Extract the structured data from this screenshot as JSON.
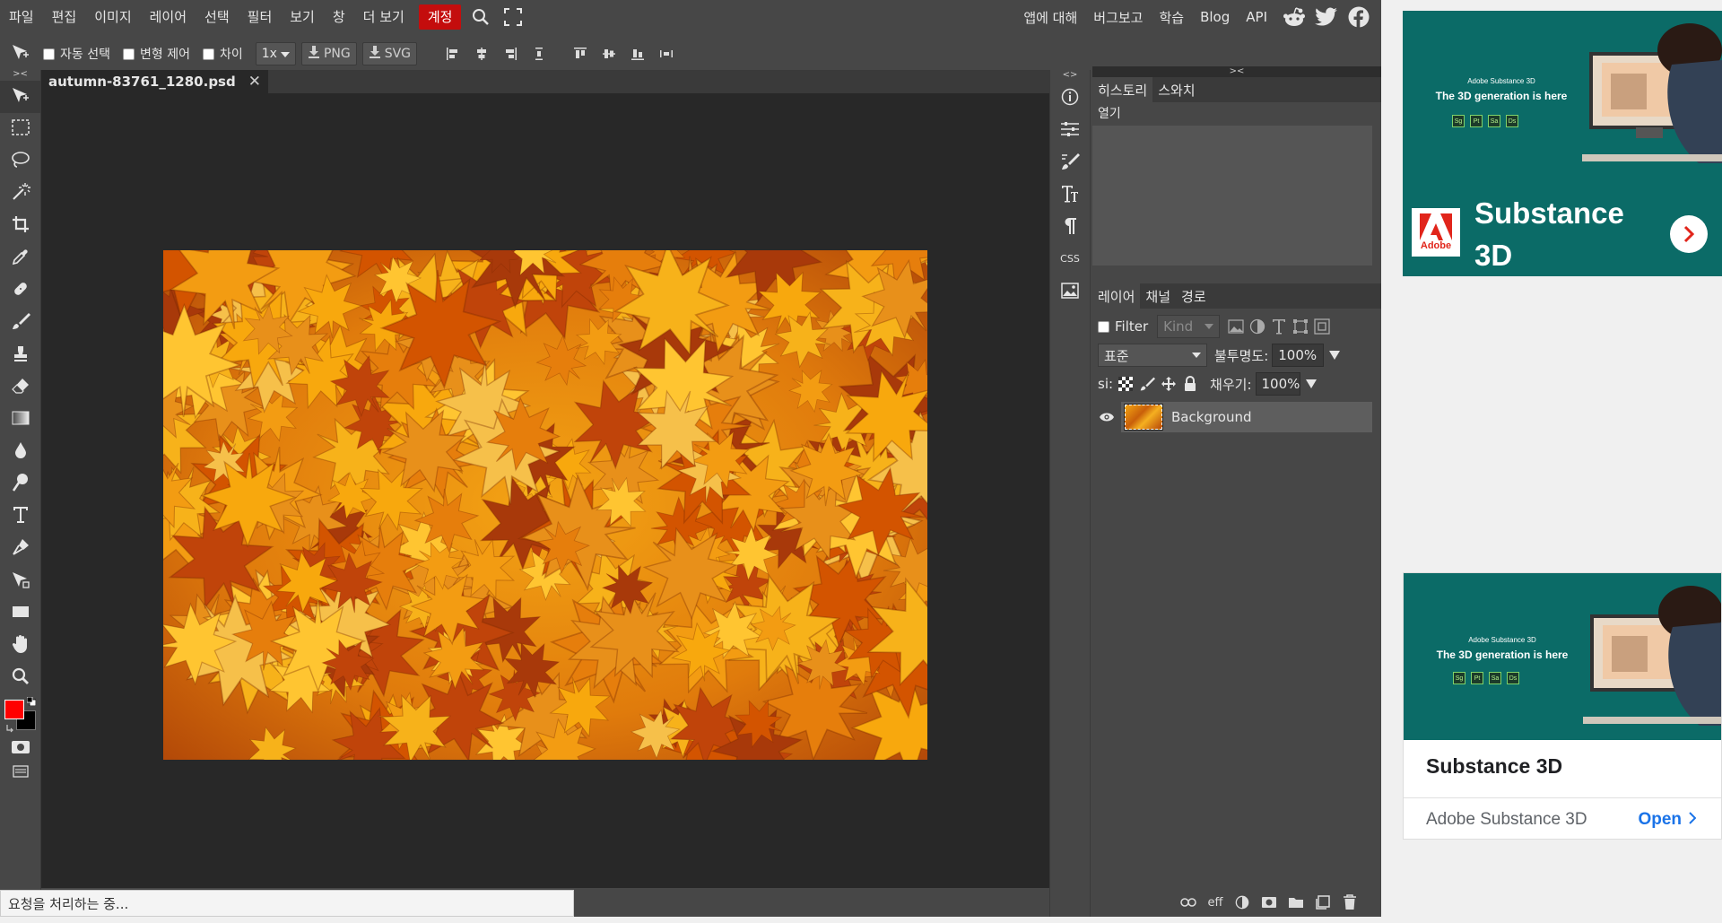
{
  "menubar": {
    "items": [
      "파일",
      "편집",
      "이미지",
      "레이어",
      "선택",
      "필터",
      "보기",
      "창",
      "더 보기"
    ],
    "account": "계정",
    "right_links": [
      "앱에 대해",
      "버그보고",
      "학습",
      "Blog",
      "API"
    ]
  },
  "options": {
    "auto_select": "자동 선택",
    "transform": "변형 제어",
    "distance": "차이",
    "zoom": "1x",
    "png": "PNG",
    "svg": "SVG"
  },
  "document": {
    "tab_name": "autumn-83761_1280.psd",
    "close_symbol": "✕"
  },
  "toolbar": {
    "collapse": "><",
    "tools": [
      "move-tool",
      "marquee-tool",
      "lasso-tool",
      "magic-wand-tool",
      "crop-tool",
      "eyedropper-tool",
      "healing-tool",
      "brush-tool",
      "clone-stamp-tool",
      "eraser-tool",
      "gradient-tool",
      "blur-tool",
      "dodge-tool",
      "type-tool",
      "pen-tool",
      "path-select-tool",
      "shape-tool",
      "hand-tool",
      "zoom-tool"
    ],
    "foreground_color": "#ff0000",
    "background_color": "#000000"
  },
  "mid_column": {
    "collapse": "<>",
    "css_label": "CSS"
  },
  "history_panel": {
    "collapse": "><",
    "tabs": [
      "히스토리",
      "스와치"
    ],
    "items": [
      "열기"
    ]
  },
  "layers_panel": {
    "tabs": [
      "레이어",
      "채널",
      "경로"
    ],
    "filter_label": "Filter",
    "kind_label": "Kind",
    "blend_mode": "표준",
    "opacity_label": "불투명도:",
    "opacity_value": "100%",
    "lock_label": "si:",
    "fill_label": "채우기:",
    "fill_value": "100%",
    "layers": [
      {
        "name": "Background",
        "visible": true
      }
    ],
    "footer_eff": "eff"
  },
  "status": {
    "text": "요청을 처리하는 중..."
  },
  "ads": {
    "ad1": {
      "brand_small": "Adobe Substance 3D",
      "tagline": "The 3D generation is here",
      "badges": [
        "Sg",
        "Pt",
        "Sa",
        "Ds"
      ],
      "logo_text": "Adobe",
      "headline": "Substance 3D"
    },
    "ad2": {
      "brand_small": "Adobe Substance 3D",
      "tagline": "The 3D generation is here",
      "badges": [
        "Sg",
        "Pt",
        "Sa",
        "Ds"
      ],
      "headline": "Substance 3D",
      "advertiser": "Adobe Substance 3D",
      "cta": "Open"
    }
  },
  "colors": {
    "accent_account": "#c40d0d",
    "panel_bg": "#474747",
    "canvas_bg": "#282828"
  }
}
